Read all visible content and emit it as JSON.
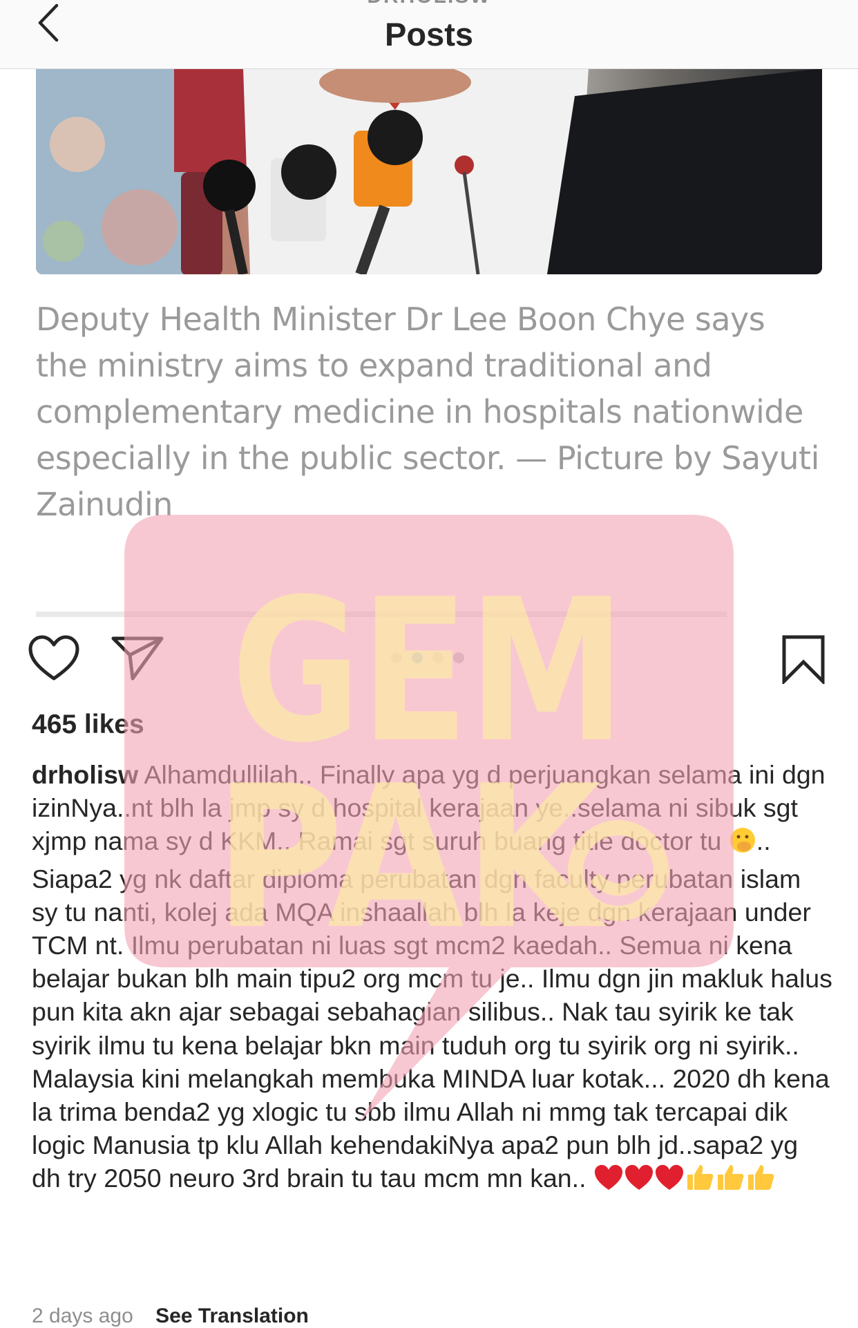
{
  "header": {
    "username": "DRHOLISW",
    "title": "Posts"
  },
  "post": {
    "image": {
      "caption_text": "Deputy Health Minister Dr Lee Boon Chye says the ministry aims to expand traditional and complementary medicine in hospitals nationwide especially in the public sector. — Picture by Sayuti Zainudin",
      "carousel": {
        "count": 4,
        "active_index": 1
      }
    },
    "likes": "465 likes",
    "caption": {
      "username": "drholisw",
      "paragraph1": " Alhamdullilah.. Finally apa yg d perjuangkan selama ini dgn izinNya..nt blh la jmp sy d hospital kerajaan ye..selama ni sibuk sgt xjmp nama sy d KKM.. Ramai sgt suruh buang title doctor tu ",
      "paragraph1_end": "..",
      "paragraph2": "Siapa2 yg nk daftar diploma perubatan dgn faculty perubatan islam sy tu nanti, kolej ada MQA inshaallah blh la keje dgn kerajaan under TCM nt. Ilmu perubatan ni luas sgt mcm2 kaedah.. Semua ni kena belajar bukan blh main tipu2 org mcm tu je.. Ilmu dgn jin makluk halus pun kita akn ajar sebagai sebahagian silibus.. Nak tau syirik ke tak syirik ilmu tu kena belajar bkn main tuduh org tu syirik org ni syirik..",
      "paragraph3": "Malaysia kini melangkah membuka MINDA luar kotak... 2020 dh kena la trima benda2 yg xlogic tu sbb ilmu Allah ni mmg tak tercapai dik logic Manusia tp klu Allah kehendakiNya apa2 pun blh jd..sapa2 yg dh try 2050 neuro 3rd brain tu tau mcm mn kan.. "
    },
    "time_ago": "2 days ago",
    "see_translation": "See Translation"
  },
  "watermark": {
    "line1": "GEM",
    "line2": "PAK",
    "bubble_color": "#f4a3b4",
    "text_color": "#fde8a8"
  },
  "icons": {
    "back": "chevron-left-icon",
    "like": "heart-icon",
    "share": "paper-plane-icon",
    "save": "bookmark-icon",
    "caption_emojis": [
      "face-with-hand-over-mouth-icon",
      "red-heart-icon",
      "red-heart-icon",
      "red-heart-icon",
      "thumbs-up-icon",
      "thumbs-up-icon",
      "thumbs-up-icon"
    ]
  },
  "colors": {
    "accent_dot": "#3897f0",
    "caption_grey": "#9a9a9a"
  }
}
